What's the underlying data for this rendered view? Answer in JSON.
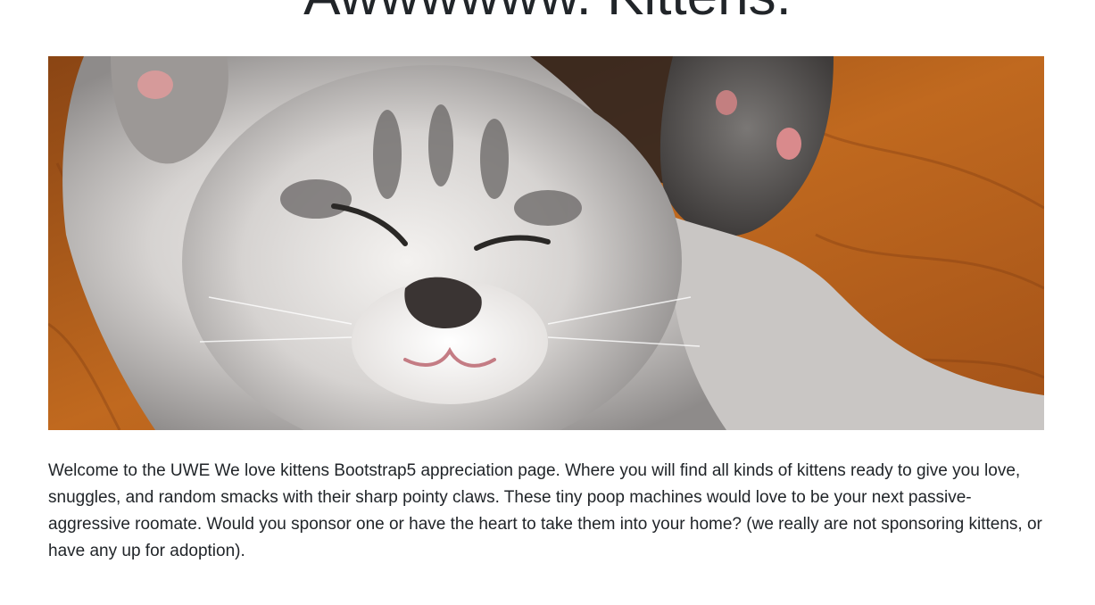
{
  "page": {
    "title": "Awwwwww. Kittens.",
    "hero_image": {
      "subject": "sleeping-kitten-photo"
    },
    "intro_text": "Welcome to the UWE We love kittens Bootstrap5 appreciation page. Where you will find all kinds of kittens ready to give you love, snuggles, and random smacks with their sharp pointy claws. These tiny poop machines would love to be your next passive-aggressive roomate. Would you sponsor one or have the heart to take them into your home? (we really are not sponsoring kittens, or have any up for adoption)."
  }
}
